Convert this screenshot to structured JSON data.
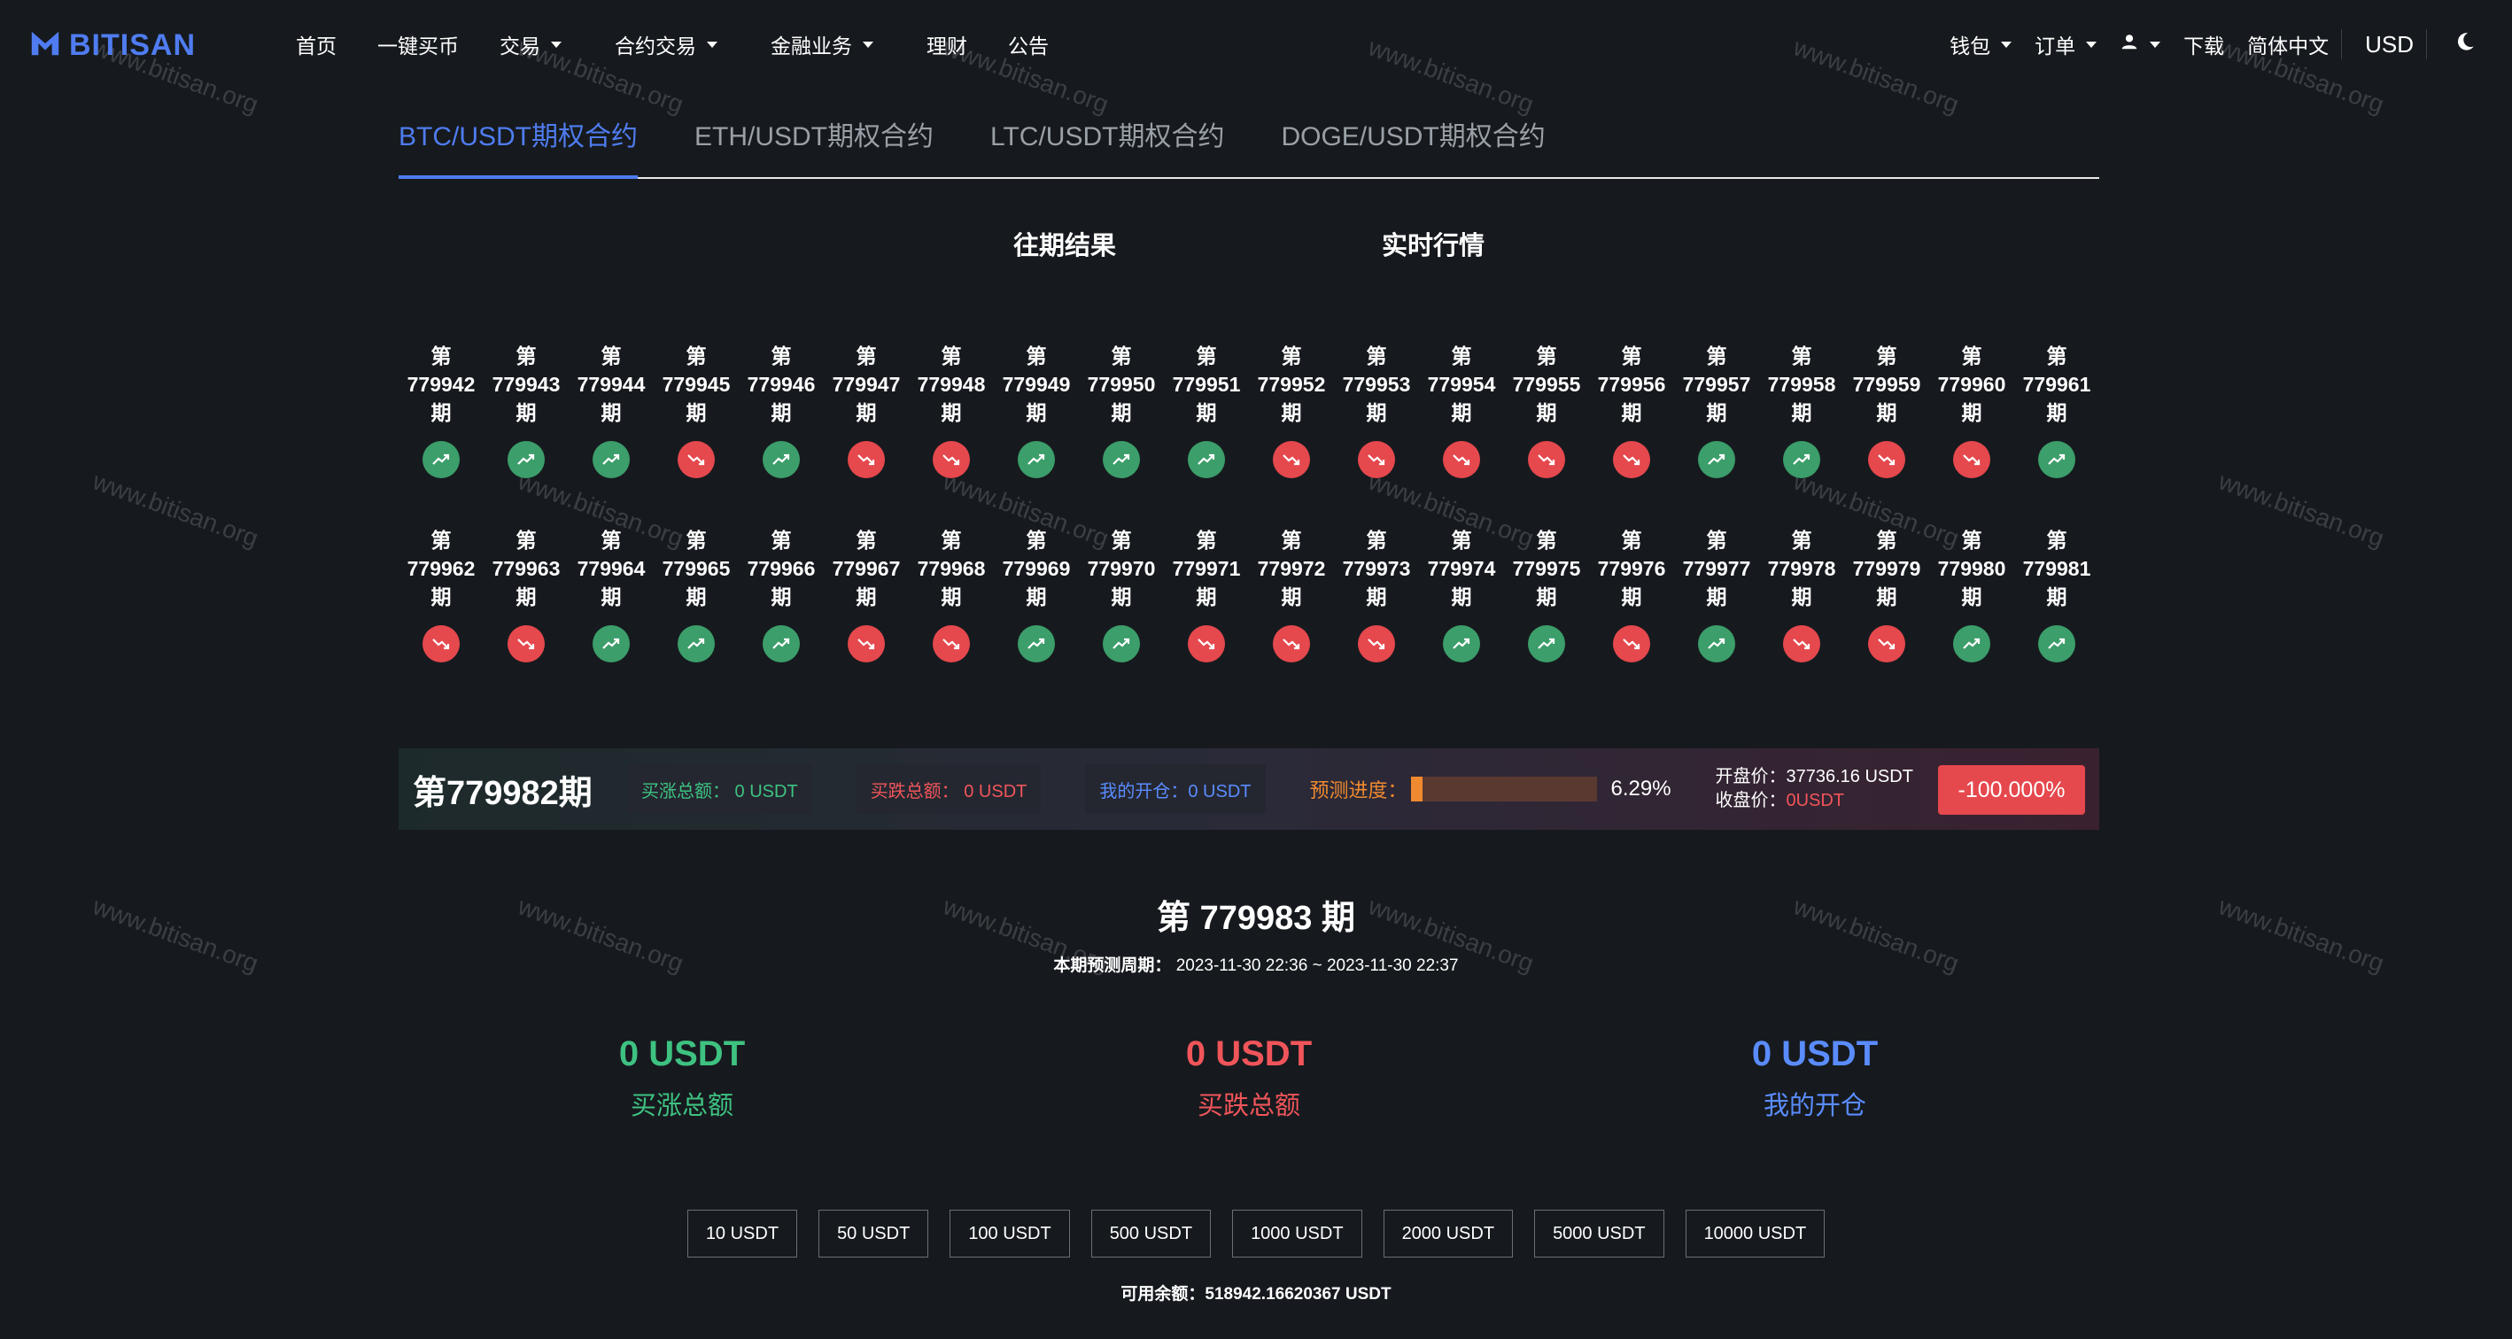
{
  "watermark": "www.bitisan.org",
  "header": {
    "logo_text": "BITISAN",
    "nav": [
      {
        "label": "首页",
        "dropdown": false
      },
      {
        "label": "一键买币",
        "dropdown": false
      },
      {
        "label": "交易",
        "dropdown": true
      },
      {
        "label": "合约交易",
        "dropdown": true
      },
      {
        "label": "金融业务",
        "dropdown": true
      },
      {
        "label": "理财",
        "dropdown": false
      },
      {
        "label": "公告",
        "dropdown": false
      }
    ],
    "right": {
      "wallet": "钱包",
      "orders": "订单",
      "download": "下载",
      "language": "简体中文",
      "currency": "USD"
    }
  },
  "tabs": [
    {
      "label": "BTC/USDT期权合约",
      "active": true
    },
    {
      "label": "ETH/USDT期权合约",
      "active": false
    },
    {
      "label": "LTC/USDT期权合约",
      "active": false
    },
    {
      "label": "DOGE/USDT期权合约",
      "active": false
    }
  ],
  "subheads": {
    "history": "往期结果",
    "realtime": "实时行情"
  },
  "history": {
    "prefix": "第",
    "suffix": "期",
    "rows": [
      [
        {
          "num": "779942",
          "dir": "up"
        },
        {
          "num": "779943",
          "dir": "up"
        },
        {
          "num": "779944",
          "dir": "up"
        },
        {
          "num": "779945",
          "dir": "down"
        },
        {
          "num": "779946",
          "dir": "up"
        },
        {
          "num": "779947",
          "dir": "down"
        },
        {
          "num": "779948",
          "dir": "down"
        },
        {
          "num": "779949",
          "dir": "up"
        },
        {
          "num": "779950",
          "dir": "up"
        },
        {
          "num": "779951",
          "dir": "up"
        },
        {
          "num": "779952",
          "dir": "down"
        },
        {
          "num": "779953",
          "dir": "down"
        },
        {
          "num": "779954",
          "dir": "down"
        },
        {
          "num": "779955",
          "dir": "down"
        },
        {
          "num": "779956",
          "dir": "down"
        },
        {
          "num": "779957",
          "dir": "up"
        },
        {
          "num": "779958",
          "dir": "up"
        },
        {
          "num": "779959",
          "dir": "down"
        },
        {
          "num": "779960",
          "dir": "down"
        },
        {
          "num": "779961",
          "dir": "up"
        }
      ],
      [
        {
          "num": "779962",
          "dir": "down"
        },
        {
          "num": "779963",
          "dir": "down"
        },
        {
          "num": "779964",
          "dir": "up"
        },
        {
          "num": "779965",
          "dir": "up"
        },
        {
          "num": "779966",
          "dir": "up"
        },
        {
          "num": "779967",
          "dir": "down"
        },
        {
          "num": "779968",
          "dir": "down"
        },
        {
          "num": "779969",
          "dir": "up"
        },
        {
          "num": "779970",
          "dir": "up"
        },
        {
          "num": "779971",
          "dir": "down"
        },
        {
          "num": "779972",
          "dir": "down"
        },
        {
          "num": "779973",
          "dir": "down"
        },
        {
          "num": "779974",
          "dir": "up"
        },
        {
          "num": "779975",
          "dir": "up"
        },
        {
          "num": "779976",
          "dir": "down"
        },
        {
          "num": "779977",
          "dir": "up"
        },
        {
          "num": "779978",
          "dir": "down"
        },
        {
          "num": "779979",
          "dir": "down"
        },
        {
          "num": "779980",
          "dir": "up"
        },
        {
          "num": "779981",
          "dir": "up"
        }
      ]
    ]
  },
  "current": {
    "period": "第779982期",
    "buy_total": "买涨总额：  0 USDT",
    "sell_total": "买跌总额：  0 USDT",
    "my_open": "我的开仓：0 USDT",
    "progress_label": "预测进度：",
    "progress_value": "6.29%",
    "progress_fraction": 0.0629,
    "open_price": "开盘价：37736.16 USDT",
    "close_label": "收盘价：",
    "close_value": "0USDT",
    "change": "-100.000%"
  },
  "next": {
    "title": "第 779983 期",
    "period_label": "本期预测周期：",
    "period_range": "2023-11-30 22:36 ~ 2023-11-30 22:37"
  },
  "totals": {
    "buy": {
      "amount": "0 USDT",
      "label": "买涨总额"
    },
    "sell": {
      "amount": "0 USDT",
      "label": "买跌总额"
    },
    "mine": {
      "amount": "0 USDT",
      "label": "我的开仓"
    }
  },
  "amount_options": [
    "10 USDT",
    "50 USDT",
    "100 USDT",
    "500 USDT",
    "1000 USDT",
    "2000 USDT",
    "5000 USDT",
    "10000 USDT"
  ],
  "balance": "可用余额：518942.16620367 USDT",
  "colors": {
    "accent": "#4f7cf0",
    "up": "#3c9e6a",
    "down": "#e5484d",
    "progress": "#f08a30"
  }
}
